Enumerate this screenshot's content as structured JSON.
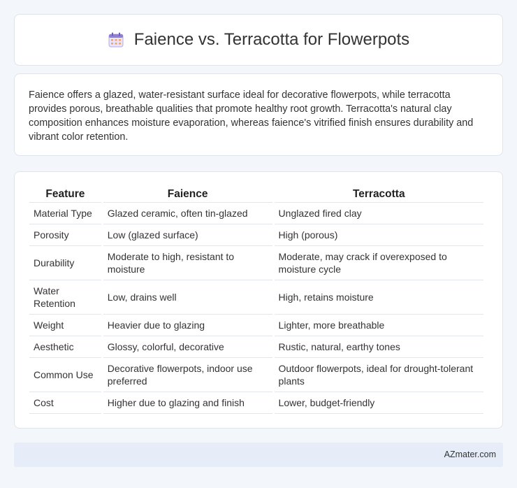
{
  "header": {
    "icon": "calendar-icon",
    "title": "Faience vs. Terracotta for Flowerpots"
  },
  "summary": {
    "text": "Faience offers a glazed, water-resistant surface ideal for decorative flowerpots, while terracotta provides porous, breathable qualities that promote healthy root growth. Terracotta's natural clay composition enhances moisture evaporation, whereas faience's vitrified finish ensures durability and vibrant color retention."
  },
  "table": {
    "headers": [
      "Feature",
      "Faience",
      "Terracotta"
    ],
    "rows": [
      [
        "Material Type",
        "Glazed ceramic, often tin-glazed",
        "Unglazed fired clay"
      ],
      [
        "Porosity",
        "Low (glazed surface)",
        "High (porous)"
      ],
      [
        "Durability",
        "Moderate to high, resistant to moisture",
        "Moderate, may crack if overexposed to moisture cycle"
      ],
      [
        "Water Retention",
        "Low, drains well",
        "High, retains moisture"
      ],
      [
        "Weight",
        "Heavier due to glazing",
        "Lighter, more breathable"
      ],
      [
        "Aesthetic",
        "Glossy, colorful, decorative",
        "Rustic, natural, earthy tones"
      ],
      [
        "Common Use",
        "Decorative flowerpots, indoor use preferred",
        "Outdoor flowerpots, ideal for drought-tolerant plants"
      ],
      [
        "Cost",
        "Higher due to glazing and finish",
        "Lower, budget-friendly"
      ]
    ]
  },
  "footer": {
    "brand": "AZmater.com"
  }
}
